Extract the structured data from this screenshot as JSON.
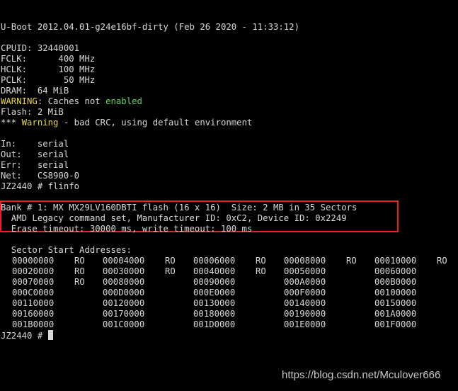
{
  "terminal": {
    "background": "#000000",
    "text_color": "#d8d8d8",
    "warning_color": "#e8d84a",
    "enabled_color": "#5fd35f",
    "highlight_color": "#e82020",
    "banner": "U-Boot 2012.04.01-g24e16bf-dirty (Feb 26 2020 - 11:33:12)",
    "cpuid": "CPUID: 32440001",
    "fclk": "FCLK:      400 MHz",
    "hclk": "HCLK:      100 MHz",
    "pclk": "PCLK:       50 MHz",
    "dram": "DRAM:  64 MiB",
    "caches_warning_label": "WARNING",
    "caches_warning_middle": ": Caches not ",
    "caches_warning_enabled": "enabled",
    "flash": "Flash: 2 MiB",
    "crc_prefix": "*** ",
    "crc_warning_label": "Warning",
    "crc_rest": " - bad CRC, using default environment",
    "in": "In:    serial",
    "out": "Out:   serial",
    "err": "Err:   serial",
    "net": "Net:   CS8900-0",
    "command": "JZ2440 # flinfo",
    "bank_line": "Bank # 1: MX MX29LV160DBTI flash (16 x 16)  Size: 2 MB in 35 Sectors",
    "legacy_line": "  AMD Legacy command set, Manufacturer ID: 0xC2, Device ID: 0x2249",
    "timeout_line": "  Erase timeout: 30000 ms, write timeout: 100 ms",
    "sector_header": "  Sector Start Addresses:",
    "sector_rows": [
      [
        {
          "addr": "00000000",
          "flag": "RO"
        },
        {
          "addr": "00004000",
          "flag": "RO"
        },
        {
          "addr": "00006000",
          "flag": "RO"
        },
        {
          "addr": "00008000",
          "flag": "RO"
        },
        {
          "addr": "00010000",
          "flag": "RO"
        }
      ],
      [
        {
          "addr": "00020000",
          "flag": "RO"
        },
        {
          "addr": "00030000",
          "flag": "RO"
        },
        {
          "addr": "00040000",
          "flag": "RO"
        },
        {
          "addr": "00050000",
          "flag": ""
        },
        {
          "addr": "00060000",
          "flag": ""
        }
      ],
      [
        {
          "addr": "00070000",
          "flag": "RO"
        },
        {
          "addr": "00080000",
          "flag": ""
        },
        {
          "addr": "00090000",
          "flag": ""
        },
        {
          "addr": "000A0000",
          "flag": ""
        },
        {
          "addr": "000B0000",
          "flag": ""
        }
      ],
      [
        {
          "addr": "000C0000",
          "flag": ""
        },
        {
          "addr": "000D0000",
          "flag": ""
        },
        {
          "addr": "000E0000",
          "flag": ""
        },
        {
          "addr": "000F0000",
          "flag": ""
        },
        {
          "addr": "00100000",
          "flag": ""
        }
      ],
      [
        {
          "addr": "00110000",
          "flag": ""
        },
        {
          "addr": "00120000",
          "flag": ""
        },
        {
          "addr": "00130000",
          "flag": ""
        },
        {
          "addr": "00140000",
          "flag": ""
        },
        {
          "addr": "00150000",
          "flag": ""
        }
      ],
      [
        {
          "addr": "00160000",
          "flag": ""
        },
        {
          "addr": "00170000",
          "flag": ""
        },
        {
          "addr": "00180000",
          "flag": ""
        },
        {
          "addr": "00190000",
          "flag": ""
        },
        {
          "addr": "001A0000",
          "flag": ""
        }
      ],
      [
        {
          "addr": "001B0000",
          "flag": ""
        },
        {
          "addr": "001C0000",
          "flag": ""
        },
        {
          "addr": "001D0000",
          "flag": ""
        },
        {
          "addr": "001E0000",
          "flag": ""
        },
        {
          "addr": "001F0000",
          "flag": ""
        }
      ]
    ],
    "prompt": "JZ2440 # "
  },
  "watermark": "https://blog.csdn.net/Mculover666"
}
